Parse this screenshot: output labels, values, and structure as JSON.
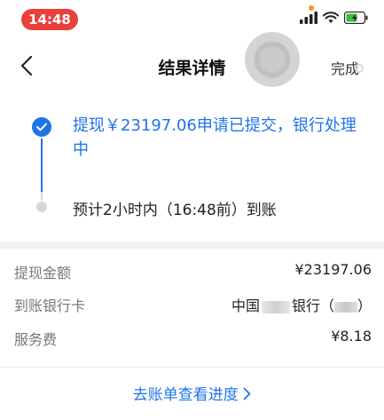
{
  "status_bar": {
    "time": "14:48",
    "battery_color": "#3bbf3b"
  },
  "nav": {
    "title": "结果详情",
    "done_label": "完成"
  },
  "progress": {
    "step1": "提现￥23197.06申请已提交，银行处理中",
    "step2": "预计2小时内（16:48前）到账",
    "accent_color": "#1f74e8"
  },
  "details": {
    "rows": [
      {
        "label": "提现金额",
        "value_prefix": "",
        "value": "¥23197.06"
      },
      {
        "label": "到账银行卡",
        "value_prefix": "中国",
        "value": "银行（",
        "value_suffix": "）"
      },
      {
        "label": "服务费",
        "value_prefix": "",
        "value": "¥8.18"
      }
    ]
  },
  "footer": {
    "link_label": "去账单查看进度"
  }
}
